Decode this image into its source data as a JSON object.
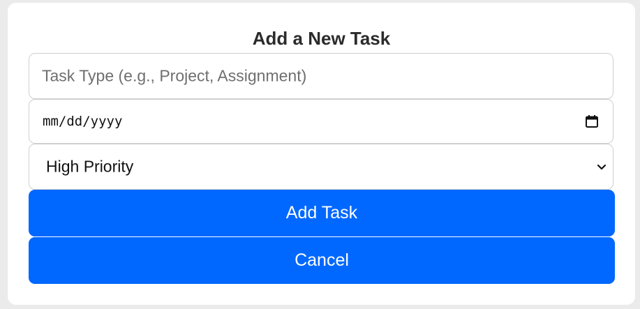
{
  "form": {
    "title": "Add a New Task",
    "task_type": {
      "placeholder": "Task Type (e.g., Project, Assignment)",
      "value": ""
    },
    "due_date": {
      "display": "mm/dd/yyyy",
      "icon": "calendar-icon"
    },
    "priority": {
      "selected": "High Priority",
      "icon": "chevron-down-icon"
    },
    "add_button_label": "Add Task",
    "cancel_button_label": "Cancel"
  },
  "colors": {
    "accent": "#0068fe",
    "background": "#ebebeb",
    "card": "#ffffff",
    "border": "#cfcfcf"
  }
}
